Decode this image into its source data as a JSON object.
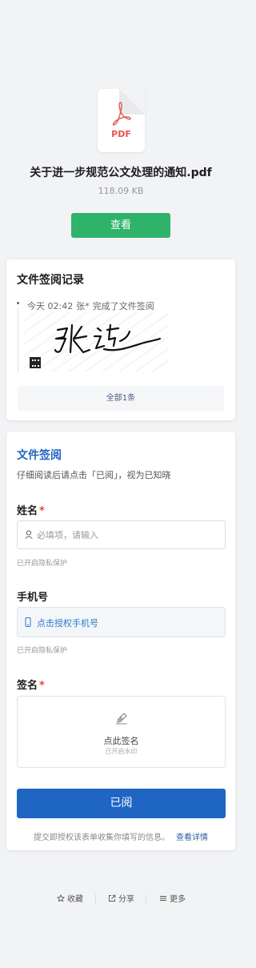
{
  "file": {
    "icon_ext": "PDF",
    "name": "关于进一步规范公文处理的通知.pdf",
    "size": "118.09 KB",
    "view_label": "查看"
  },
  "records": {
    "title": "文件签阅记录",
    "items": [
      {
        "time": "今天 02:42",
        "user": "张*",
        "action": "完成了文件签阅",
        "signature_text": "张远"
      }
    ],
    "all_label": "全部1条"
  },
  "form": {
    "title": "文件签阅",
    "description": "仔细阅读后请点击「已阅」，视为已知晓",
    "name_field": {
      "label": "姓名",
      "required_mark": "*",
      "placeholder": "必填项，请输入",
      "hint": "已开启隐私保护"
    },
    "phone_field": {
      "label": "手机号",
      "auth_label": "点击授权手机号",
      "hint": "已开启隐私保护"
    },
    "signature_field": {
      "label": "签名",
      "required_mark": "*",
      "action_label": "点此签名",
      "watermark_label": "已开启水印"
    },
    "submit_label": "已阅",
    "consent_text": "提交即授权该表单收集你填写的信息。",
    "consent_link": "查看详情"
  },
  "bottom_bar": {
    "favorite": "收藏",
    "share": "分享",
    "more": "更多"
  },
  "colors": {
    "view_button": "#2fb36b",
    "primary": "#1f66c3",
    "required": "#e94538",
    "pdf": "#e5564d"
  }
}
